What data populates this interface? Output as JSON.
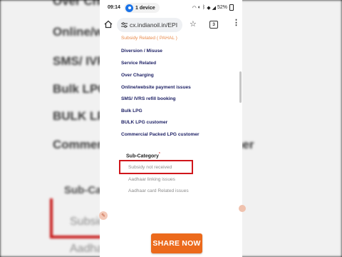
{
  "background": {
    "items": [
      "Over Charging",
      "Online/website payment issues",
      "SMS/ IVRS refill booking",
      "Bulk LPG",
      "BULK LPG customer",
      "Commercial Packed LPG customer"
    ],
    "sub_category_label": "Sub-Category",
    "selected_option": "Subsidy not received",
    "next_option": "Aadhaar linking issues"
  },
  "status_bar": {
    "time": "09:14",
    "device_label": "1 device",
    "battery": "52%"
  },
  "browser": {
    "url": "cx.indianoil.in/EPI",
    "tab_count": "3"
  },
  "categories": [
    "Subsidy Related ( PAHAL )",
    "Diversion / Misuse",
    "Service Related",
    "Over Charging",
    "Online/website payment issues",
    "SMS/ IVRS refill booking",
    "Bulk LPG",
    "BULK LPG customer",
    "Commercial Packed LPG customer"
  ],
  "sub_category": {
    "label": "Sub-Category",
    "required_mark": "*",
    "options": [
      "Subsidy not received",
      "Aadhaar linking issues",
      "Aadhaar card Related issues"
    ]
  },
  "share_button": "SHARE NOW",
  "colors": {
    "accent_orange": "#ec6a1c",
    "highlight_red": "#d0161b",
    "category_navy": "#1f2266"
  }
}
